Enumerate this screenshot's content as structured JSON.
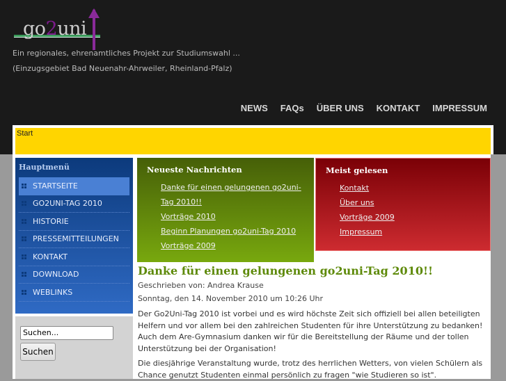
{
  "logo": {
    "text_a": "go",
    "text_b": "2",
    "text_c": "uni"
  },
  "header": {
    "tagline1": "Ein regionales, ehrenamtliches Projekt zur Studiumswahl ...",
    "tagline2": "(Einzugsgebiet Bad Neuenahr-Ahrweiler, Rheinland-Pfalz)"
  },
  "nav": [
    "NEWS",
    "FAQs",
    "ÜBER UNS",
    "KONTAKT",
    "IMPRESSUM"
  ],
  "breadcrumb": "Start",
  "menu": {
    "title": "Hauptmenü",
    "items": [
      "STARTSEITE",
      "GO2UNI-TAG 2010",
      "HISTORIE",
      "PRESSEMITTEILUNGEN",
      "KONTAKT",
      "DOWNLOAD",
      "WEBLINKS"
    ]
  },
  "search": {
    "placeholder": "Suchen...",
    "button": "Suchen"
  },
  "latest": {
    "title": "Neueste Nachrichten",
    "items": [
      "Danke für einen gelungenen go2uni-Tag 2010!!",
      "Vorträge 2010",
      "Beginn Planungen go2uni-Tag 2010",
      "Vorträge 2009"
    ]
  },
  "popular": {
    "title": "Meist gelesen",
    "items": [
      "Kontakt",
      "Über uns",
      "Vorträge 2009",
      "Impressum"
    ]
  },
  "article": {
    "title": "Danke für einen gelungenen go2uni-Tag 2010!!",
    "author": "Geschrieben von: Andrea Krause",
    "date": "Sonntag, den 14. November 2010 um 10:26 Uhr",
    "p1": "Der Go2Uni-Tag 2010 ist vorbei und es wird höchste Zeit sich offiziell bei allen beteiligten Helfern und vor allem bei den zahlreichen Studenten für ihre Unterstützung zu bedanken! Auch dem Are-Gymnasium danken wir für die Bereitstellung der Räume und der tollen Unterstützung bei der Organisation!",
    "p2": "Die diesjährige Veranstaltung wurde, trotz des herrlichen Wetters, von vielen Schülern als Chance genutzt Studenten einmal persönlich zu fragen \"wie Studieren so ist\"."
  }
}
